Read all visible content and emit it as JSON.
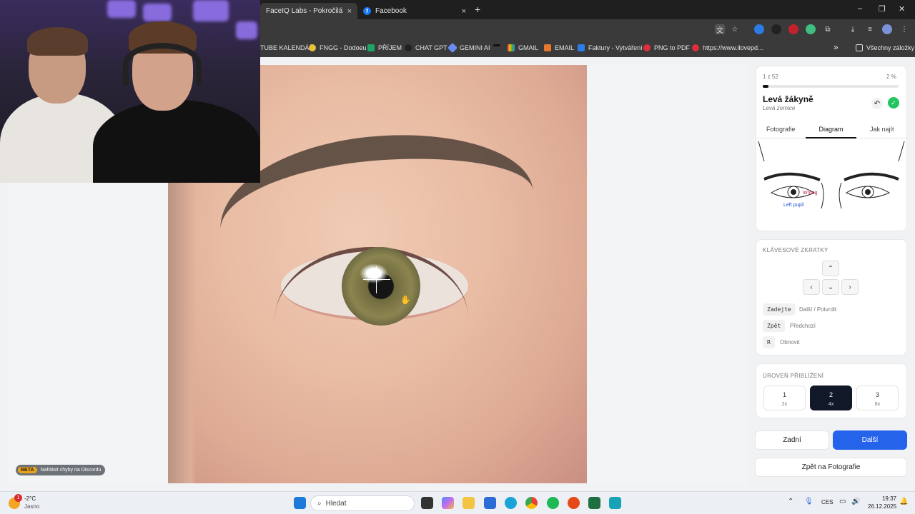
{
  "browser": {
    "tabs": [
      {
        "title": "FaceIQ Labs - Pokročilá analýza",
        "close": "×"
      },
      {
        "title": "Facebook",
        "close": "×"
      }
    ],
    "new_tab": "+",
    "window_controls": [
      "–",
      "❐",
      "✕"
    ],
    "bookmarks": [
      "TUBE KALENDÁŘ",
      "FNGG - Dodoeu",
      "PŘÍJEM",
      "CHAT GPT",
      "GEMINI AI",
      "GMAIL",
      "EMAIL",
      "Faktury - Vytváření",
      "PNG to PDF",
      "https://www.ilovepd..."
    ],
    "bookmarks_overflow": "»",
    "all_bookmarks": "Všechny záložky"
  },
  "beta": {
    "badge": "BETA",
    "text": "Nahlásit chyby na Discordu"
  },
  "sidebar": {
    "counter": "1 z 52",
    "percent": "2 %",
    "progress_fraction": 0.02,
    "title": "Levá žákyně",
    "subtitle": "Levá zornice",
    "tabs": [
      "Fotografie",
      "Diagram",
      "Jak najít"
    ],
    "active_tab": "Diagram",
    "diagram": {
      "wrong": "Wrong",
      "left_pupil": "Left pupil"
    },
    "shortcuts_title": "KLÁVESOVÉ ZKRATKY",
    "arrows": {
      "up": "⌃",
      "left": "‹",
      "down": "⌄",
      "right": "›"
    },
    "shortcuts": [
      {
        "key": "Zadejte",
        "label": "Další / Potvrdit"
      },
      {
        "key": "Zpět",
        "label": "Předchozí"
      },
      {
        "key": "R",
        "label": "Obnovit"
      }
    ],
    "zoom_title": "ÚROVEŇ PŘIBLÍŽENÍ",
    "zoom_levels": [
      {
        "n": "1",
        "s": "2x"
      },
      {
        "n": "2",
        "s": "4x"
      },
      {
        "n": "3",
        "s": "8x"
      }
    ],
    "selected_zoom": "2",
    "back_button": "Zadní",
    "next_button": "Další",
    "photo_button": "Zpět na Fotografie"
  },
  "taskbar": {
    "weather_temp": "-2°C",
    "weather_text": "Jasno",
    "weather_badge": "1",
    "search_placeholder": "Hledat",
    "lang": "CES",
    "time": "19:37",
    "date": "26.12.2025"
  }
}
